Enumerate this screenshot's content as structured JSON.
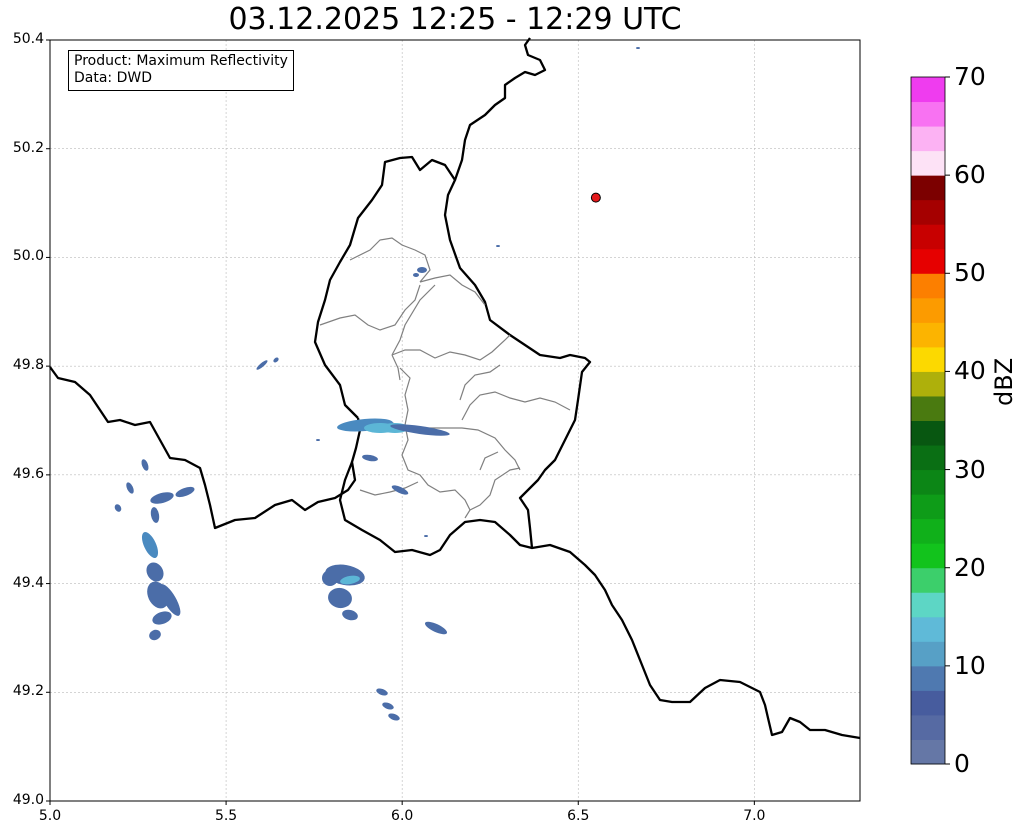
{
  "title": "03.12.2025 12:25 - 12:29 UTC",
  "info": {
    "product": "Product: Maximum Reflectivity",
    "data": "Data: DWD"
  },
  "axes": {
    "lon_range": [
      5.0,
      7.3
    ],
    "lat_range": [
      49.0,
      50.4
    ],
    "x_ticks": [
      "5.0",
      "5.5",
      "6.0",
      "6.5",
      "7.0"
    ],
    "y_ticks": [
      "49.0",
      "49.2",
      "49.4",
      "49.6",
      "49.8",
      "50.0",
      "50.2",
      "50.4"
    ],
    "grid": true
  },
  "marker": {
    "lon": 6.55,
    "lat": 50.11,
    "color": "#e41a1c"
  },
  "colorbar": {
    "unit": "dBZ",
    "range": [
      0,
      70
    ],
    "tick_labels": [
      "0",
      "10",
      "20",
      "30",
      "40",
      "50",
      "60",
      "70"
    ],
    "colors": [
      "#6577a6",
      "#566aa3",
      "#475c9e",
      "#4f79b0",
      "#57a0c6",
      "#5fbad8",
      "#5dd6c5",
      "#3ccf6b",
      "#12c31c",
      "#10b01a",
      "#0e9c18",
      "#0c8616",
      "#0a6f14",
      "#085711",
      "#4a7a10",
      "#aeb00b",
      "#fcd900",
      "#fcb400",
      "#fc9b00",
      "#fc7f00",
      "#e60000",
      "#c80000",
      "#a50000",
      "#7c0000",
      "#fde2f6",
      "#fcb2f3",
      "#f872f2",
      "#ef3cef"
    ]
  },
  "echo_colors": {
    "low": "#4b6da8",
    "mid": "#4a8ac0",
    "high": "#5cb6d6"
  }
}
